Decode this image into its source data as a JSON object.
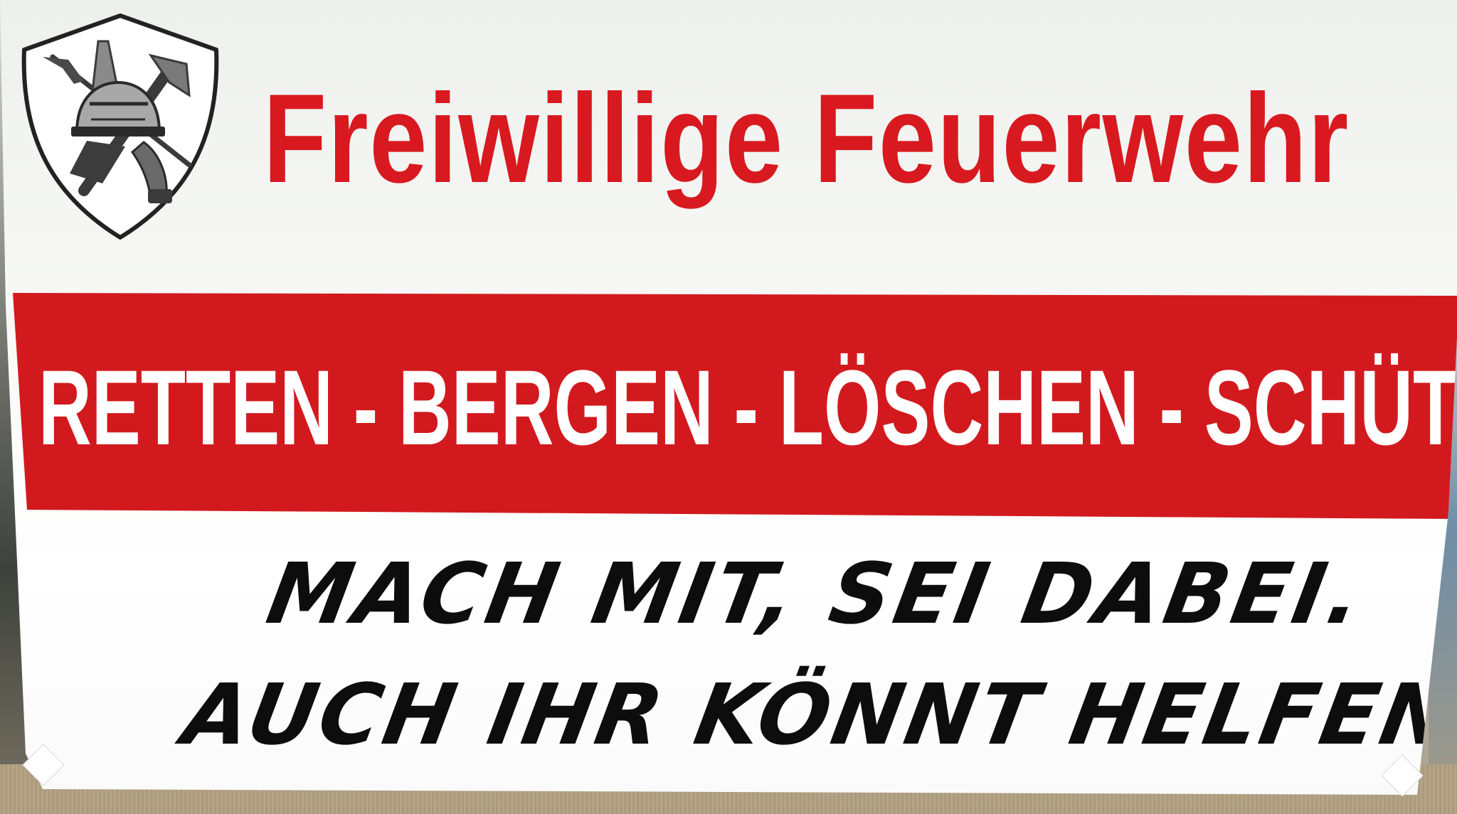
{
  "sign": {
    "headline": "Freiwillige Feuerwehr",
    "motto": "RETTEN - BERGEN - LÖSCHEN - SCHÜTZEN",
    "slogan_line_1": "MACH MIT, SEI DABEI.",
    "slogan_line_2": "AUCH IHR KÖNNT HELFEN.",
    "emblem": "fire-brigade-emblem"
  },
  "colors": {
    "red": "#d21a1e",
    "text_black": "#0d0d0d",
    "background_white": "#ffffff",
    "emblem_gray": "#5a5a5a"
  }
}
